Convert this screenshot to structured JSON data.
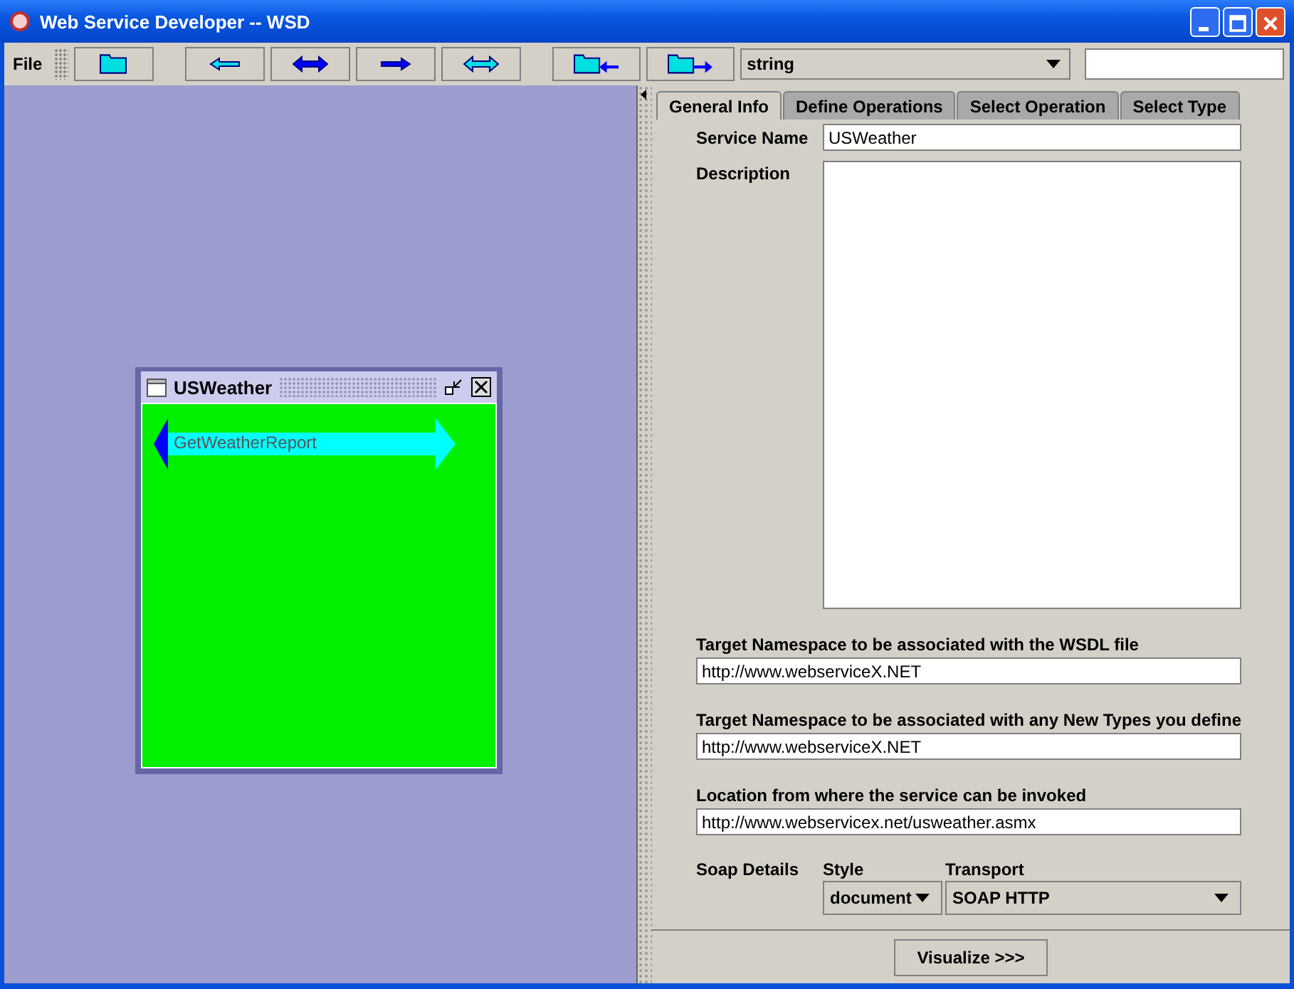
{
  "window": {
    "title": "Web Service Developer -- WSD"
  },
  "toolbar": {
    "menu": "File",
    "buttons": [
      {
        "kind": "folder"
      },
      {
        "kind": "left"
      },
      {
        "kind": "both"
      },
      {
        "kind": "right"
      },
      {
        "kind": "both-cyan"
      },
      {
        "kind": "folder-left"
      },
      {
        "kind": "folder-right"
      }
    ],
    "type_combo": "string"
  },
  "canvas": {
    "frame": {
      "title": "USWeather",
      "operations": [
        {
          "name": "GetWeatherReport"
        }
      ]
    }
  },
  "tabs": [
    {
      "label": "General Info",
      "selected": true
    },
    {
      "label": "Define Operations",
      "selected": false
    },
    {
      "label": "Select Operation",
      "selected": false
    },
    {
      "label": "Select Type",
      "selected": false
    }
  ],
  "form": {
    "service_name_label": "Service Name",
    "service_name": "USWeather",
    "description_label": "Description",
    "fields": [
      {
        "label": "Target Namespace to be associated with the WSDL file",
        "value": "http://www.webserviceX.NET"
      },
      {
        "label": "Target Namespace to be associated with any New Types you define",
        "value": "http://www.webserviceX.NET"
      },
      {
        "label": "Location from where the service can be invoked",
        "value": "http://www.webservicex.net/usweather.asmx"
      }
    ],
    "soap_label": "Soap Details",
    "style_label": "Style",
    "style": "document",
    "transport_label": "Transport",
    "transport": "SOAP HTTP"
  },
  "visualize_button": "Visualize >>>"
}
